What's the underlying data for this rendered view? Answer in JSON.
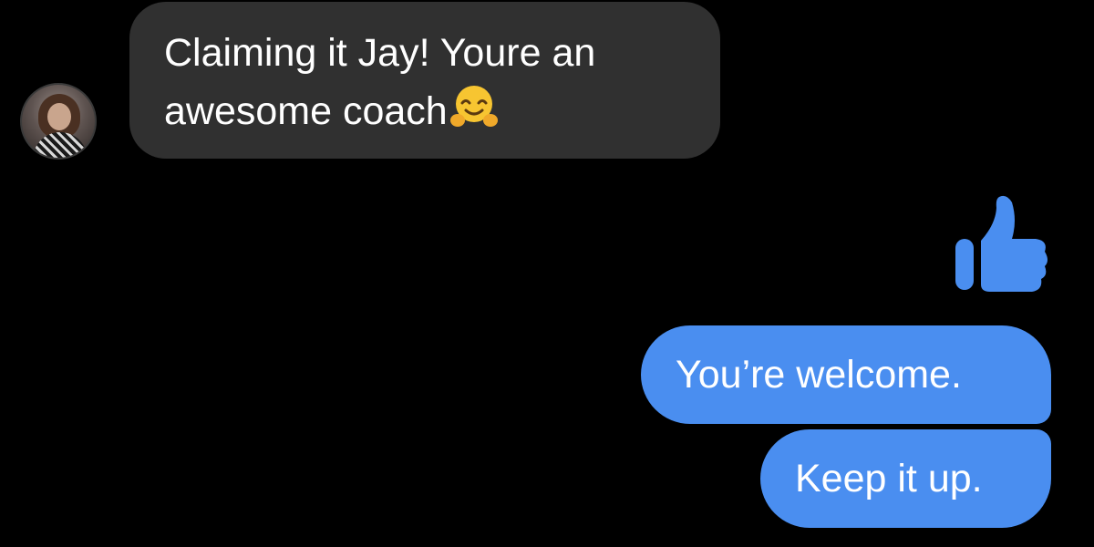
{
  "conversation": {
    "incoming": {
      "line1": "Claiming it Jay! Youre an",
      "line2": "awesome coach",
      "emoji_icon": "hugging-face-emoji"
    },
    "reaction_icon": "thumbs-up-icon",
    "outgoing": [
      {
        "text": "You’re welcome."
      },
      {
        "text": "Keep it up."
      }
    ]
  },
  "colors": {
    "background": "#000000",
    "incoming_bubble": "#303030",
    "outgoing_bubble": "#4a8ef0",
    "text": "#ffffff"
  }
}
